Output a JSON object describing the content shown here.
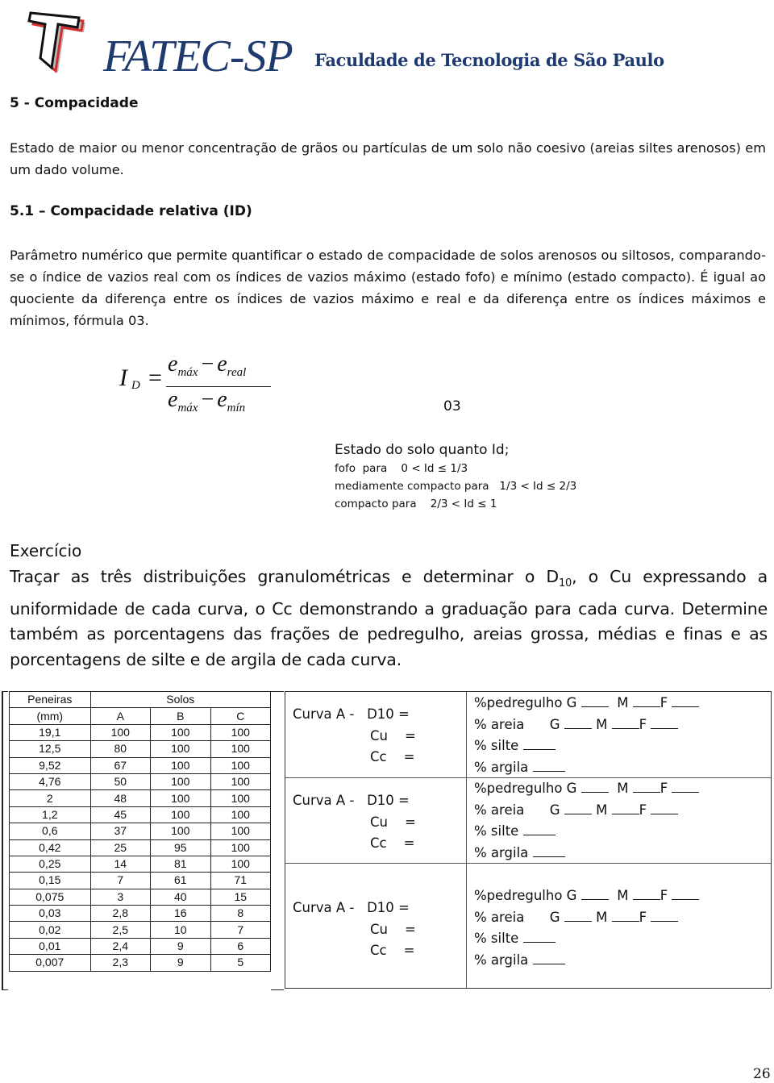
{
  "header": {
    "brand": "FATEC-SP",
    "subtitle": "Faculdade de Tecnologia de São Paulo",
    "logo_icon": "fatec-t-logo-icon",
    "brand_color": "#1e3a6e",
    "logo_accent_color": "#d32f2f"
  },
  "section": {
    "title": "5 - Compacidade",
    "intro": "Estado de maior ou menor concentração de grãos ou partículas de um solo não coesivo (areias siltes arenosos) em um dado volume.",
    "subsection_title": "5.1 – Compacidade relativa (ID)",
    "subsection_text": "Parâmetro numérico que permite quantificar o estado de compacidade de solos arenosos ou siltosos, comparando-se o índice de vazios real com os índices de vazios máximo (estado fofo) e mínimo (estado compacto). É igual ao quociente da diferença entre os índices de vazios máximo e real e da diferença entre os índices máximos e mínimos, fórmula 03."
  },
  "formula": {
    "lhs": "I",
    "lhs_sub": "D",
    "eq": "=",
    "num_a": "e",
    "num_a_sub": "máx",
    "num_b": "e",
    "num_b_sub": "real",
    "den_a": "e",
    "den_a_sub": "máx",
    "den_b": "e",
    "den_b_sub": "mín",
    "minus": "−",
    "number": "03"
  },
  "states": {
    "title": "Estado do solo quanto Id;",
    "lines": [
      "fofo  para    0 < Id ≤ 1/3",
      "mediamente compacto para   1/3 < Id ≤ 2/3",
      "compacto para    2/3 < Id ≤ 1"
    ]
  },
  "exercise": {
    "title": "Exercício",
    "body_before_sub": "Traçar as três distribuições granulométricas e determinar o D",
    "body_sub": "10",
    "body_after_sub": ", o Cu expressando a uniformidade de cada curva, o Cc demonstrando a graduação para cada curva. Determine também as porcentagens das frações de pedregulho, areias grossa, médias e finas e as porcentagens de silte e de argila de cada curva."
  },
  "sieve_table": {
    "header_col0_line1": "Peneiras",
    "header_group": "Solos",
    "header_col0_line2": "(mm)",
    "columns": [
      "A",
      "B",
      "C"
    ],
    "rows": [
      [
        "19,1",
        "100",
        "100",
        "100"
      ],
      [
        "12,5",
        "80",
        "100",
        "100"
      ],
      [
        "9,52",
        "67",
        "100",
        "100"
      ],
      [
        "4,76",
        "50",
        "100",
        "100"
      ],
      [
        "2",
        "48",
        "100",
        "100"
      ],
      [
        "1,2",
        "45",
        "100",
        "100"
      ],
      [
        "0,6",
        "37",
        "100",
        "100"
      ],
      [
        "0,42",
        "25",
        "95",
        "100"
      ],
      [
        "0,25",
        "14",
        "81",
        "100"
      ],
      [
        "0,15",
        "7",
        "61",
        "71"
      ],
      [
        "0,075",
        "3",
        "40",
        "15"
      ],
      [
        "0,03",
        "2,8",
        "16",
        "8"
      ],
      [
        "0,02",
        "2,5",
        "10",
        "7"
      ],
      [
        "0,01",
        "2,4",
        "9",
        "6"
      ],
      [
        "0,007",
        "2,3",
        "9",
        "5"
      ]
    ]
  },
  "results": [
    {
      "curva": "Curva A -   D10 =",
      "cu": "Cu    =",
      "cc": "Cc    =",
      "pedregulho": "%pedregulho G",
      "areia": "% areia      G",
      "silte": "% silte",
      "argila": "% argila",
      "m": "M",
      "f": "F"
    },
    {
      "curva": "Curva A -   D10 =",
      "cu": "Cu    =",
      "cc": "Cc    =",
      "pedregulho": "%pedregulho G",
      "areia": "% areia      G",
      "silte": "% silte",
      "argila": "% argila",
      "m": "M",
      "f": "F"
    },
    {
      "curva": "Curva A -   D10 =",
      "cu": "Cu    =",
      "cc": "Cc    =",
      "pedregulho": "%pedregulho G",
      "areia": "% areia      G",
      "silte": "% silte",
      "argila": "% argila",
      "m": "M",
      "f": "F"
    }
  ],
  "page_number": "26"
}
